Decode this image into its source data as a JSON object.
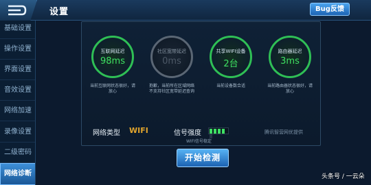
{
  "header": {
    "title": "设置",
    "bug_button": "Bug反馈",
    "back_icon": "back-arrow-icon"
  },
  "sidebar": {
    "items": [
      {
        "label": "基础设置",
        "active": false
      },
      {
        "label": "操作设置",
        "active": false
      },
      {
        "label": "界面设置",
        "active": false
      },
      {
        "label": "音效设置",
        "active": false
      },
      {
        "label": "网络加速",
        "active": false
      },
      {
        "label": "录像设置",
        "active": false
      },
      {
        "label": "二级密码",
        "active": false
      },
      {
        "label": "网络诊断",
        "active": true
      }
    ]
  },
  "diagnostics": {
    "metrics": [
      {
        "label": "互联网延迟",
        "value": "98ms",
        "desc": "当前互联网状态很好，请放心",
        "status": "good"
      },
      {
        "label": "社区宽带延迟",
        "value": "0ms",
        "desc": "抱歉，当前所在区域网络不支持社区宽带延迟查询",
        "status": "unavailable"
      },
      {
        "label": "共享WIFI设备",
        "value": "2台",
        "desc": "当前设备数合适",
        "status": "good"
      },
      {
        "label": "路由器延迟",
        "value": "3ms",
        "desc": "当前路由器状态很好，请放心",
        "status": "good"
      }
    ],
    "network_type_label": "网络类型",
    "network_type_value": "WIFI",
    "signal_label": "信号强度",
    "signal_bars_on": 4,
    "signal_bars_total": 5,
    "signal_note": "WIFI信号稳定",
    "brand_note": "腾讯智营网优提供",
    "start_button": "开始检测"
  },
  "watermarks": {
    "author": "头条号 / 一云朵"
  },
  "colors": {
    "good": "#3ee064",
    "unavailable": "#5a6674",
    "accent": "#1c62b2",
    "wifi": "#e2a52d"
  }
}
